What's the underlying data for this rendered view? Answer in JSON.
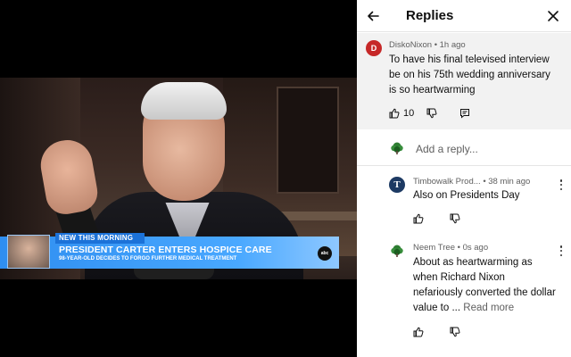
{
  "video": {
    "lower_third": {
      "tag": "NEW THIS MORNING",
      "headline": "PRESIDENT CARTER ENTERS HOSPICE CARE",
      "subheadline": "98-YEAR-OLD DECIDES TO FORGO FURTHER MEDICAL TREATMENT",
      "network_logo": "abc",
      "bar_color": "#2f8ef0"
    }
  },
  "panel": {
    "title": "Replies",
    "back_icon": "arrow-left-icon",
    "close_icon": "close-icon"
  },
  "main_comment": {
    "avatar_letter": "D",
    "avatar_color": "#c62828",
    "author": "DiskoNixon",
    "time": "• 1h ago",
    "text": "To have his final televised interview be on his 75th wedding anniversary is so heartwarming",
    "like_count": "10"
  },
  "add_reply": {
    "placeholder": "Add a reply..."
  },
  "replies": [
    {
      "author": "Timbowalk Prod...",
      "time": "• 38 min ago",
      "avatar_letter": "T",
      "text": "Also on Presidents Day"
    },
    {
      "author": "Neem Tree",
      "time": "• 0s ago",
      "text": "About as heartwarming as when Richard Nixon nefariously converted the dollar value to ...",
      "read_more": "Read more"
    }
  ]
}
